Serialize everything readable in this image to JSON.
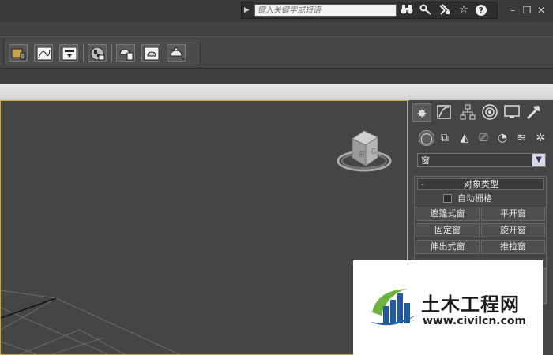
{
  "search": {
    "placeholder": "键入关键字或短语",
    "icons": [
      "binoculars-icon",
      "key-icon",
      "satellite-icon",
      "star-icon",
      "help-icon"
    ]
  },
  "window_controls": {
    "minimize": "–",
    "restore": "❐",
    "close": "✕"
  },
  "command_panel": {
    "tabs": [
      "create-icon",
      "modify-icon",
      "hierarchy-icon",
      "motion-icon",
      "display-icon",
      "utilities-icon"
    ],
    "categories": [
      "geometry-icon",
      "shapes-icon",
      "lights-icon",
      "cameras-icon",
      "helpers-icon",
      "spacewarps-icon",
      "systems-icon"
    ],
    "dropdown_value": "窗",
    "rollout": {
      "toggle": "-",
      "title": "对象类型",
      "autogrid_label": "自动栅格",
      "buttons": [
        "遮篷式窗",
        "平开窗",
        "固定窗",
        "旋开窗",
        "伸出式窗",
        "推拉窗"
      ]
    }
  },
  "watermark": {
    "title": "土木工程网",
    "url": "www.civilcn.com"
  },
  "colors": {
    "viewport_border": "#c9a54a",
    "dropdown_button": "#d8d8e8",
    "logo_blue": "#1f5aa6",
    "logo_green": "#6cb43f"
  }
}
